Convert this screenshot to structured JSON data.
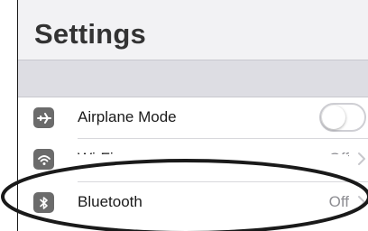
{
  "header": {
    "title": "Settings"
  },
  "rows": [
    {
      "label": "Airplane Mode",
      "icon": "airplane-icon",
      "control": "toggle",
      "toggle_on": false
    },
    {
      "label": "Wi-Fi",
      "icon": "wifi-icon",
      "value": "Off",
      "chevron": true
    },
    {
      "label": "Bluetooth",
      "icon": "bluetooth-icon",
      "value": "Off",
      "chevron": true
    }
  ],
  "colors": {
    "header_bg": "#f2f2f4",
    "group_band": "#dddde3",
    "icon_bg": "#6b6b6b",
    "title_text": "#333333",
    "value_text": "#8e8e93",
    "annotation_ellipse": "#1a1a1a"
  }
}
